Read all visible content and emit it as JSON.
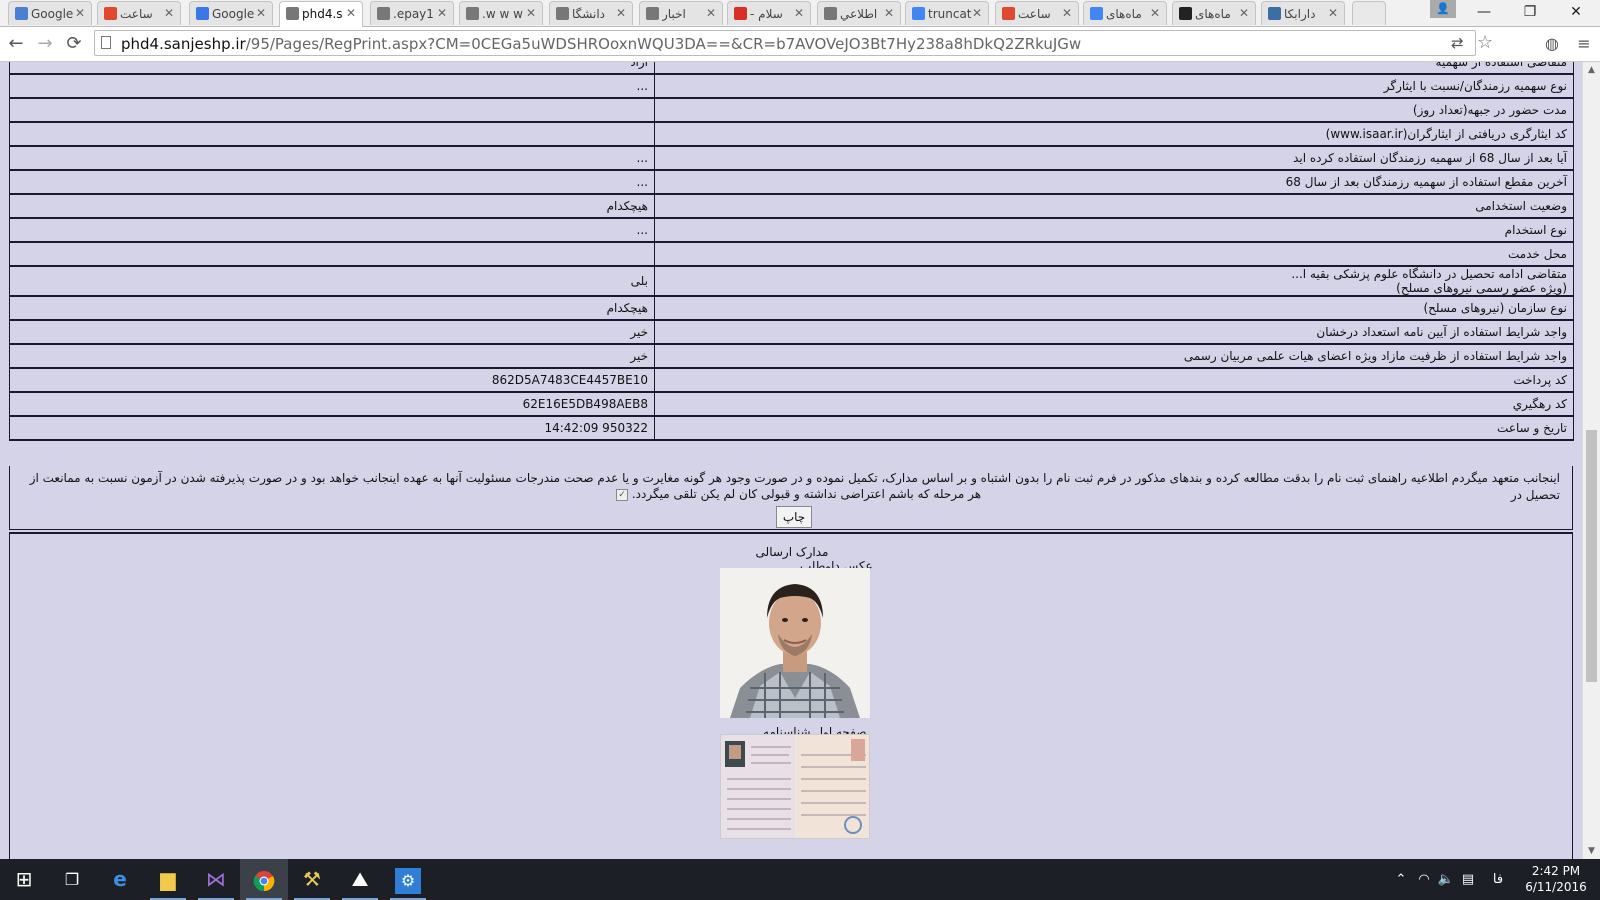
{
  "browser": {
    "tabs": [
      {
        "title": "Google",
        "icon": "google-translate-icon",
        "color": "#4a7fd4"
      },
      {
        "title": "ساعت",
        "icon": "time-ir-icon",
        "color": "#e0492f"
      },
      {
        "title": "Google",
        "icon": "google-calendar-icon",
        "color": "#3b78e7"
      },
      {
        "title": "phd4.s",
        "icon": "page-icon",
        "color": "#777777",
        "active": true
      },
      {
        "title": "epay1.",
        "icon": "page-icon",
        "color": "#777777"
      },
      {
        "title": "w w w.",
        "icon": "page-icon",
        "color": "#777777"
      },
      {
        "title": "دانشگا",
        "icon": "page-icon",
        "color": "#777777"
      },
      {
        "title": "اخبار",
        "icon": "page-icon",
        "color": "#777777"
      },
      {
        "title": "سلام -",
        "icon": "gmail-icon",
        "color": "#d93025"
      },
      {
        "title": "اطلاعي",
        "icon": "page-icon",
        "color": "#777777"
      },
      {
        "title": "truncat",
        "icon": "google-icon",
        "color": "#4285f4"
      },
      {
        "title": "ساعت",
        "icon": "time-ir-icon",
        "color": "#e0492f"
      },
      {
        "title": "ماه‌های",
        "icon": "google-icon",
        "color": "#4285f4"
      },
      {
        "title": "ماه‌های",
        "icon": "wikipedia-icon",
        "color": "#222222"
      },
      {
        "title": "دارابکا",
        "icon": "site-icon",
        "color": "#3a6ea5"
      }
    ],
    "url_host": "phd4.sanjeshp.ir",
    "url_rest": "/95/Pages/RegPrint.aspx?CM=0CEGa5uWDSHROoxnWQU3DA==&CR=b7AVOVeJO3Bt7Hy238a8hDkQ2ZRkuJGw",
    "window_controls": {
      "minimize": "—",
      "maximize": "❐",
      "close": "✕"
    }
  },
  "form": {
    "rows": [
      {
        "label": "متقاضی استفاده از سهمیه",
        "value": "آزاد"
      },
      {
        "label": "نوع سهمیه رزمندگان/نسبت با ایثارگر",
        "value": "..."
      },
      {
        "label": "مدت حضور در  جبهه(تعداد روز)",
        "value": ""
      },
      {
        "label": "کد ایثارگری دریافتی از ایثارگران(www.isaar.ir)",
        "value": ""
      },
      {
        "label": "آیا بعد از سال 68 از سهمیه رزمندگان استفاده کرده اید",
        "value": "..."
      },
      {
        "label": "آخرین مقطع استفاده از سهمیه رزمندگان بعد از سال 68",
        "value": "..."
      },
      {
        "label": "وضعیت استخدامی",
        "value": "هیچکدام"
      },
      {
        "label": "نوع استخدام",
        "value": "..."
      },
      {
        "label": "محل خدمت",
        "value": ""
      },
      {
        "label": "متقاضی ادامه تحصیل در دانشگاه علوم پزشکی بقیه ا...",
        "label2": "(ویژه عضو رسمی نیروهای مسلح)",
        "value": "بلی",
        "tall": true
      },
      {
        "label": "نوع سازمان (نیروهای مسلح)",
        "value": "هیچکدام"
      },
      {
        "label": "واجد شرایط استفاده از آیین نامه استعداد درخشان",
        "value": "خیر"
      },
      {
        "label": "واجد شرایط استفاده از ظرفیت مازاد ویژه اعضای هیات علمی مربیان رسمی",
        "value": "خیر"
      },
      {
        "label": "کد پرداخت",
        "value": "862D5A7483CE4457BE10",
        "ltr": true
      },
      {
        "label": "کد رهگیري",
        "value": "62E16E5DB498AEB8",
        "ltr": true
      },
      {
        "label": "تاریخ و ساعت",
        "value": "14:42:09  950322",
        "ltr": true
      }
    ],
    "declaration_line1": "اینجانب متعهد میگردم اطلاعیه راهنمای ثبت نام را بدقت مطالعه کرده و بندهای مذکور در فرم ثبت نام را بدون اشتباه و بر اساس مدارک، تکمیل نموده و در صورت وجود هر گونه مغایرت و یا عدم صحت مندرجات مسئولیت آنها به عهده اینجانب خواهد بود و در صورت پذیرفته شدن در آزمون نسبت به ممانعت از تحصیل در",
    "declaration_line2": "هر مرحله که باشم اعتراضی نداشته و قبولی کان لم یکن تلقی میگردد.",
    "print_button": "چاپ"
  },
  "documents": {
    "title": "مدارک ارسالی",
    "photo_caption": "عکس داوطلب",
    "id_caption": "صفحه اول شناسنامه"
  },
  "taskbar": {
    "apps": [
      "start-icon",
      "task-view-icon",
      "edge-icon",
      "file-explorer-icon",
      "visual-studio-icon",
      "chrome-icon",
      "tools-icon",
      "photos-icon",
      "settings-icon"
    ],
    "language": "فا",
    "time": "2:42 PM",
    "date": "6/11/2016"
  }
}
